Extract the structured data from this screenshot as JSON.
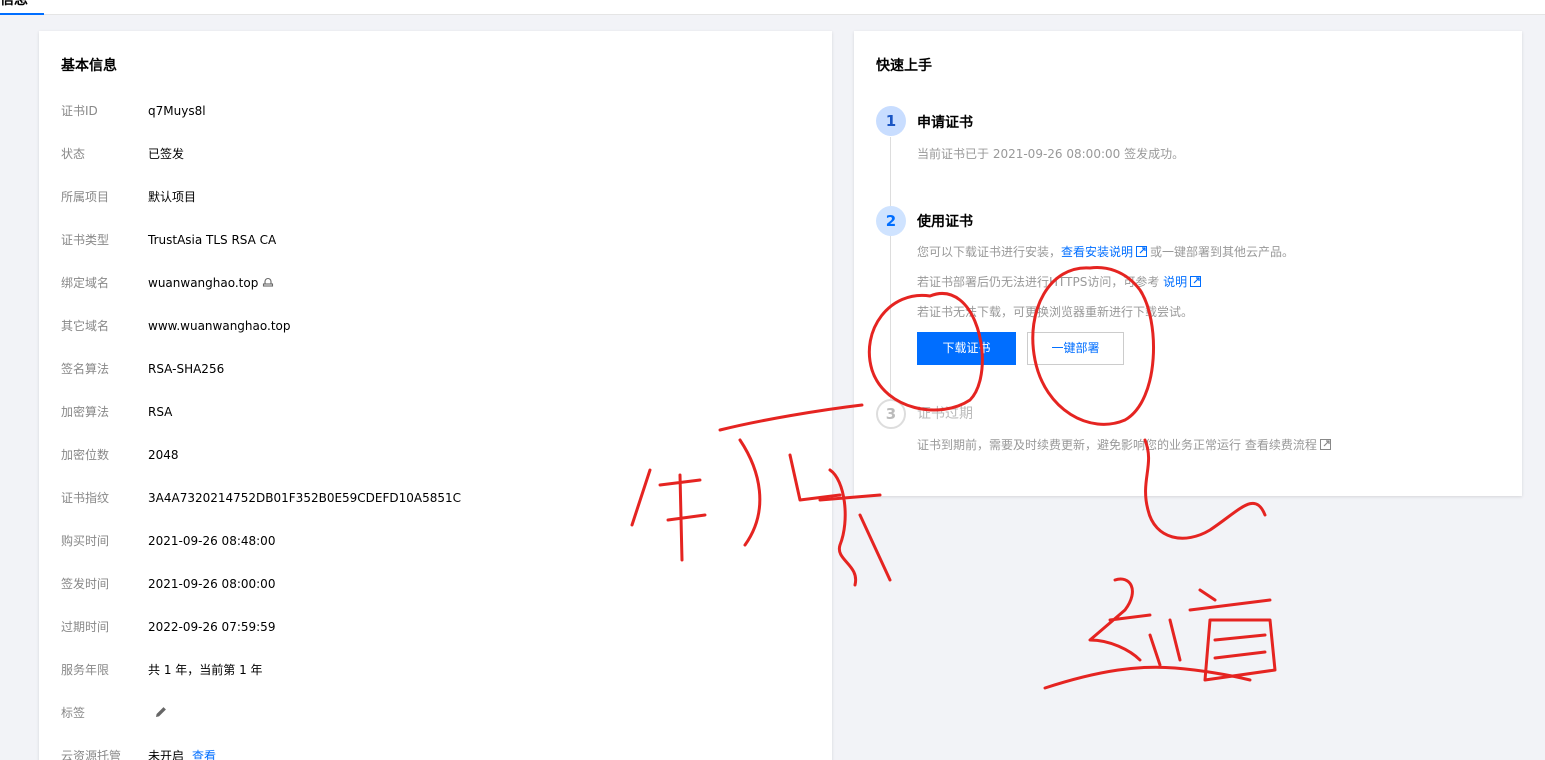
{
  "topbar": {
    "tab_label": "信息"
  },
  "basic_info": {
    "title": "基本信息",
    "rows": [
      {
        "label": "证书ID",
        "value": "q7Muys8l"
      },
      {
        "label": "状态",
        "value": "已签发"
      },
      {
        "label": "所属项目",
        "value": "默认项目"
      },
      {
        "label": "证书类型",
        "value": "TrustAsia TLS RSA CA"
      },
      {
        "label": "绑定域名",
        "value": "wuanwanghao.top"
      },
      {
        "label": "其它域名",
        "value": "www.wuanwanghao.top"
      },
      {
        "label": "签名算法",
        "value": "RSA-SHA256"
      },
      {
        "label": "加密算法",
        "value": "RSA"
      },
      {
        "label": "加密位数",
        "value": "2048"
      },
      {
        "label": "证书指纹",
        "value": "3A4A7320214752DB01F352B0E59CDEFD10A5851C"
      },
      {
        "label": "购买时间",
        "value": "2021-09-26 08:48:00"
      },
      {
        "label": "签发时间",
        "value": "2021-09-26 08:00:00"
      },
      {
        "label": "过期时间",
        "value": "2022-09-26 07:59:59"
      },
      {
        "label": "服务年限",
        "value": "共 1 年，当前第 1 年"
      },
      {
        "label": "标签",
        "value": ""
      },
      {
        "label": "云资源托管",
        "value": "未开启",
        "link": "查看"
      }
    ]
  },
  "quick_start": {
    "title": "快速上手",
    "steps": [
      {
        "num": "1",
        "title": "申请证书",
        "desc": "当前证书已于 2021-09-26 08:00:00 签发成功。"
      },
      {
        "num": "2",
        "title": "使用证书",
        "desc1_pre": "您可以下载证书进行安装，",
        "desc1_link": "查看安装说明",
        "desc1_post": "或一键部署到其他云产品。",
        "desc2_pre": "若证书部署后仍无法进行HTTPS访问，可参考",
        "desc2_link": "说明",
        "desc3": "若证书无法下载，可更换浏览器重新进行下载尝试。",
        "download_button": "下载证书",
        "deploy_button": "一键部署"
      },
      {
        "num": "3",
        "title": "证书过期",
        "desc_pre": "证书到期前，需要及时续费更新，避免影响您的业务正常运行",
        "desc_link": "查看续费流程"
      }
    ]
  },
  "annotation": {
    "color": "#e52421"
  }
}
